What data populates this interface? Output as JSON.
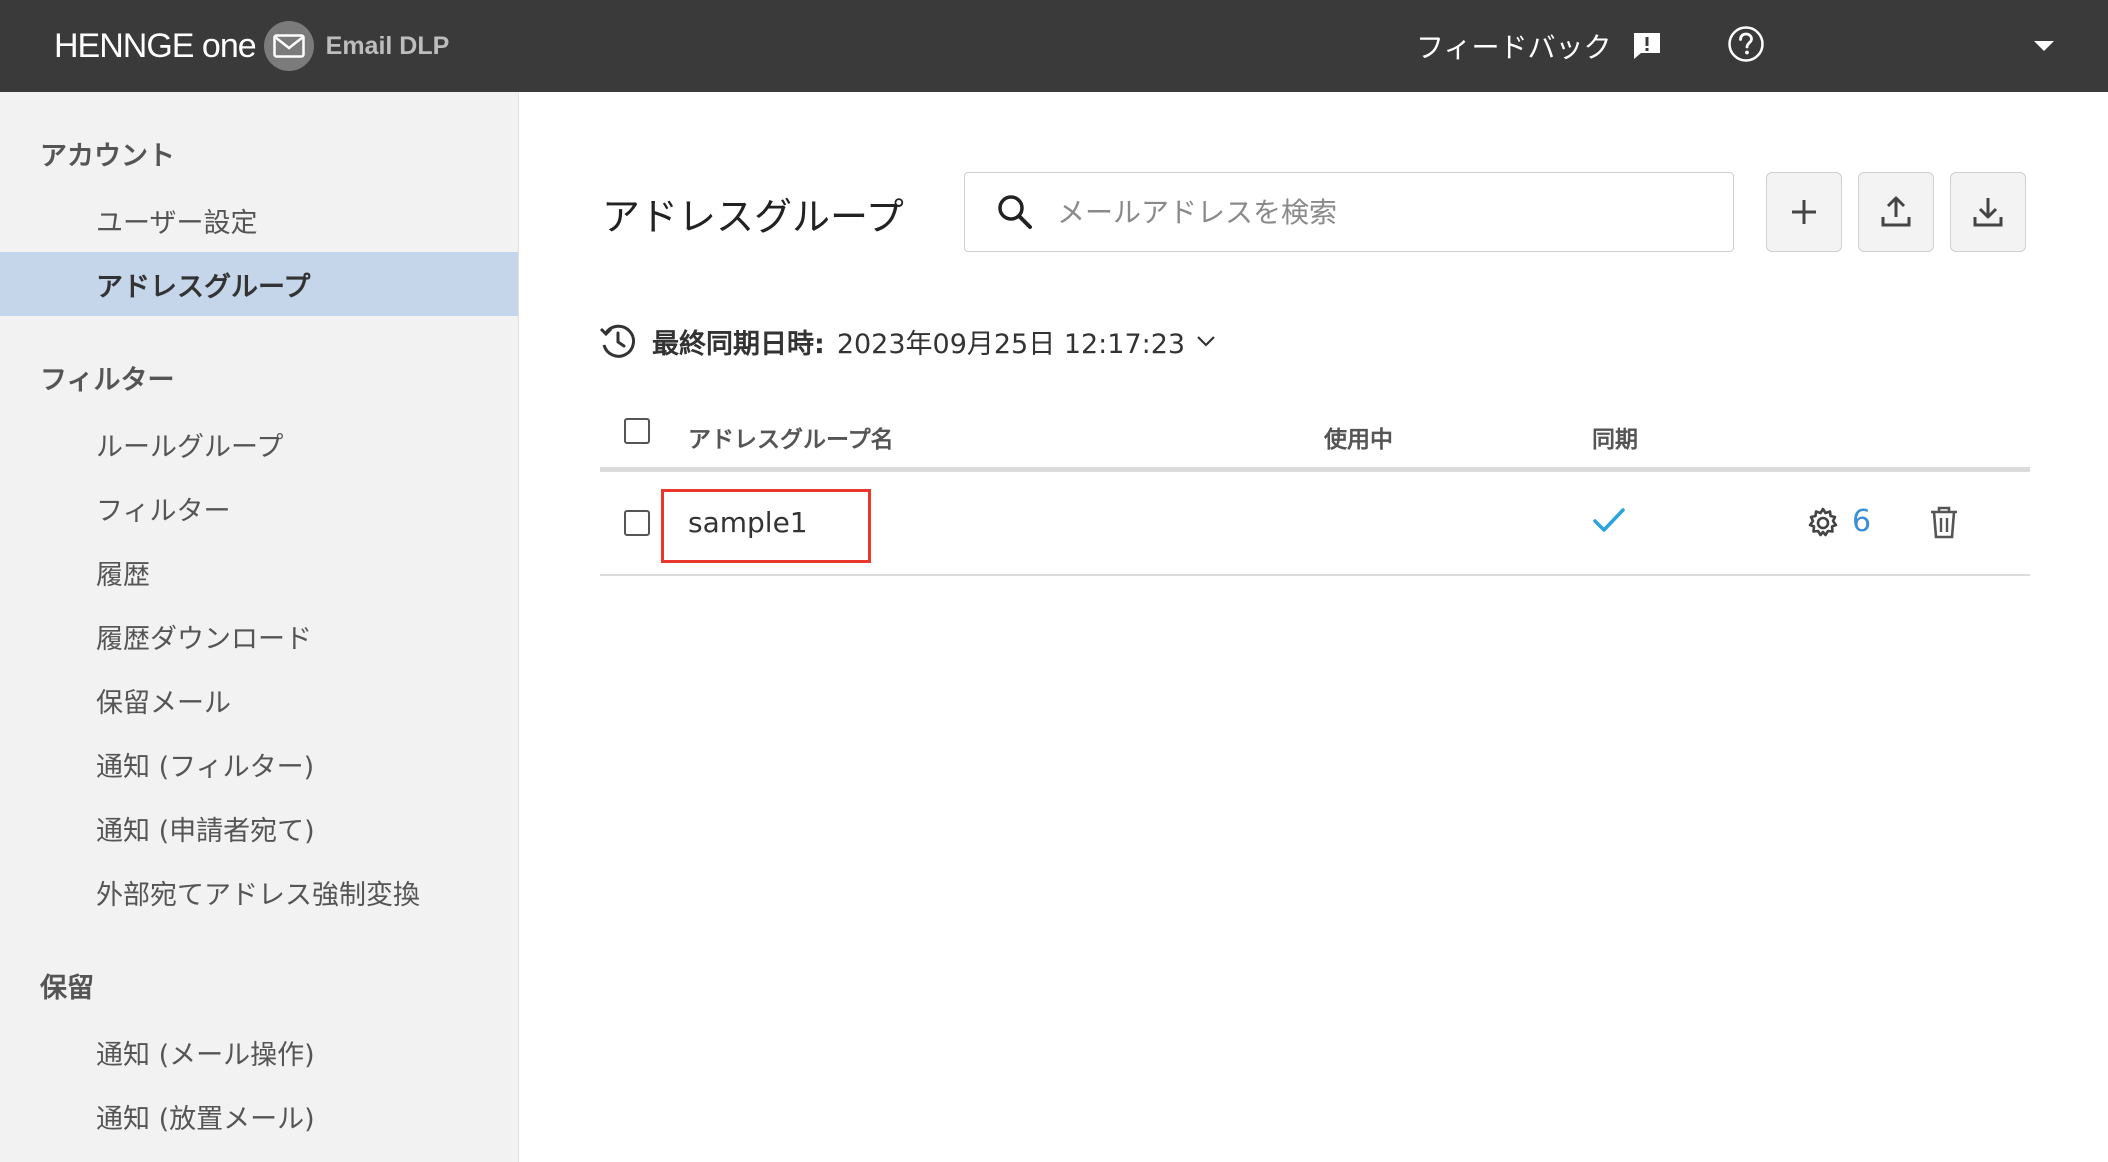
{
  "header": {
    "brand": "HENNGE one",
    "product": "Email DLP",
    "feedback_label": "フィードバック",
    "icons": {
      "mail": "mail-icon",
      "feedback": "feedback-icon",
      "help": "help-icon",
      "menu": "chevron-down-icon"
    }
  },
  "sidebar": {
    "sections": [
      {
        "title": "アカウント",
        "items": [
          {
            "label": "ユーザー設定",
            "active": false
          },
          {
            "label": "アドレスグループ",
            "active": true
          }
        ]
      },
      {
        "title": "フィルター",
        "items": [
          {
            "label": "ルールグループ",
            "active": false
          },
          {
            "label": "フィルター",
            "active": false
          },
          {
            "label": "履歴",
            "active": false
          },
          {
            "label": "履歴ダウンロード",
            "active": false
          },
          {
            "label": "保留メール",
            "active": false
          },
          {
            "label": "通知 (フィルター)",
            "active": false
          },
          {
            "label": "通知 (申請者宛て)",
            "active": false
          },
          {
            "label": "外部宛てアドレス強制変換",
            "active": false
          }
        ]
      },
      {
        "title": "保留",
        "items": [
          {
            "label": "通知 (メール操作)",
            "active": false
          },
          {
            "label": "通知 (放置メール)",
            "active": false
          }
        ]
      }
    ]
  },
  "main": {
    "title": "アドレスグループ",
    "search": {
      "placeholder": "メールアドレスを検索",
      "value": ""
    },
    "toolbar": {
      "icons": [
        "plus-icon",
        "upload-icon",
        "download-icon"
      ]
    },
    "sync": {
      "label": "最終同期日時:",
      "value": "2023年09月25日 12:17:23"
    },
    "table": {
      "columns": [
        "アドレスグループ名",
        "使用中",
        "同期"
      ],
      "rows": [
        {
          "name": "sample1",
          "in_use": "",
          "synced": true,
          "count": "6"
        }
      ]
    }
  },
  "colors": {
    "topbar": "#3a3a3a",
    "sidebar": "#f2f2f2",
    "active_item": "#c5d6ea",
    "accent_blue": "#3c8fd6",
    "check": "#2aa3e0",
    "highlight": "#e8382c"
  }
}
